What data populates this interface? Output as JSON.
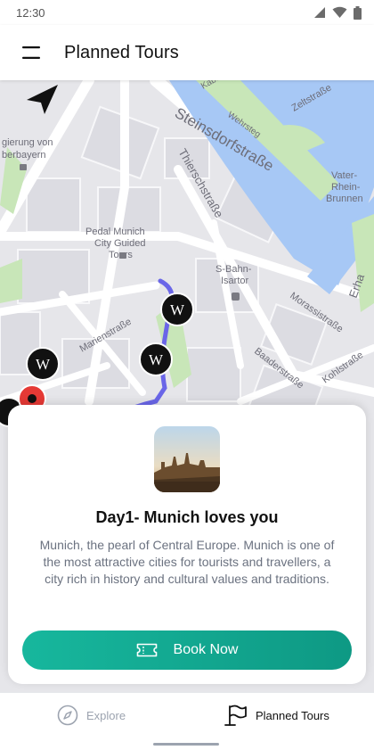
{
  "status_bar": {
    "time": "12:30"
  },
  "app_bar": {
    "title": "Planned Tours"
  },
  "map": {
    "labels": {
      "steinsdorfstrasse": "Steinsdorfstraße",
      "thierschstrasse": "Thierschstraße",
      "pedal_munich": "Pedal Munich",
      "city_guided": "City Guided",
      "tours": "Tours",
      "s_bahn": "S-Bahn-",
      "isartor": "Isartor",
      "marienstrasse": "Marienstraße",
      "morassistrasse": "Morassistraße",
      "baaderstrasse": "Baaderstraße",
      "kohlstrasse": "Kohlstraße",
      "vater_rhein": "Vater-",
      "rhein": "Rhein-",
      "brunnen": "Brunnen",
      "zeltstrasse": "Zeltstraße",
      "wehrsteg": "Wehrsteg",
      "gierung_von": "gierung von",
      "oberbayern": "berbayern",
      "erhardtstr": "Erha",
      "kabel": "Kabel",
      "wikipedia_marker": "W"
    }
  },
  "card": {
    "title": "Day1- Munich loves you",
    "description": "Munich, the pearl of Central Europe. Munich is one of the most attractive cities for tourists and travellers, a city rich in history and cultural values and traditions.",
    "button_label": "Book Now",
    "accent_color": "#12a990"
  },
  "bottom_nav": {
    "items": [
      {
        "label": "Explore",
        "icon": "compass-icon",
        "active": false
      },
      {
        "label": "Planned Tours",
        "icon": "flag-icon",
        "active": true
      }
    ]
  }
}
